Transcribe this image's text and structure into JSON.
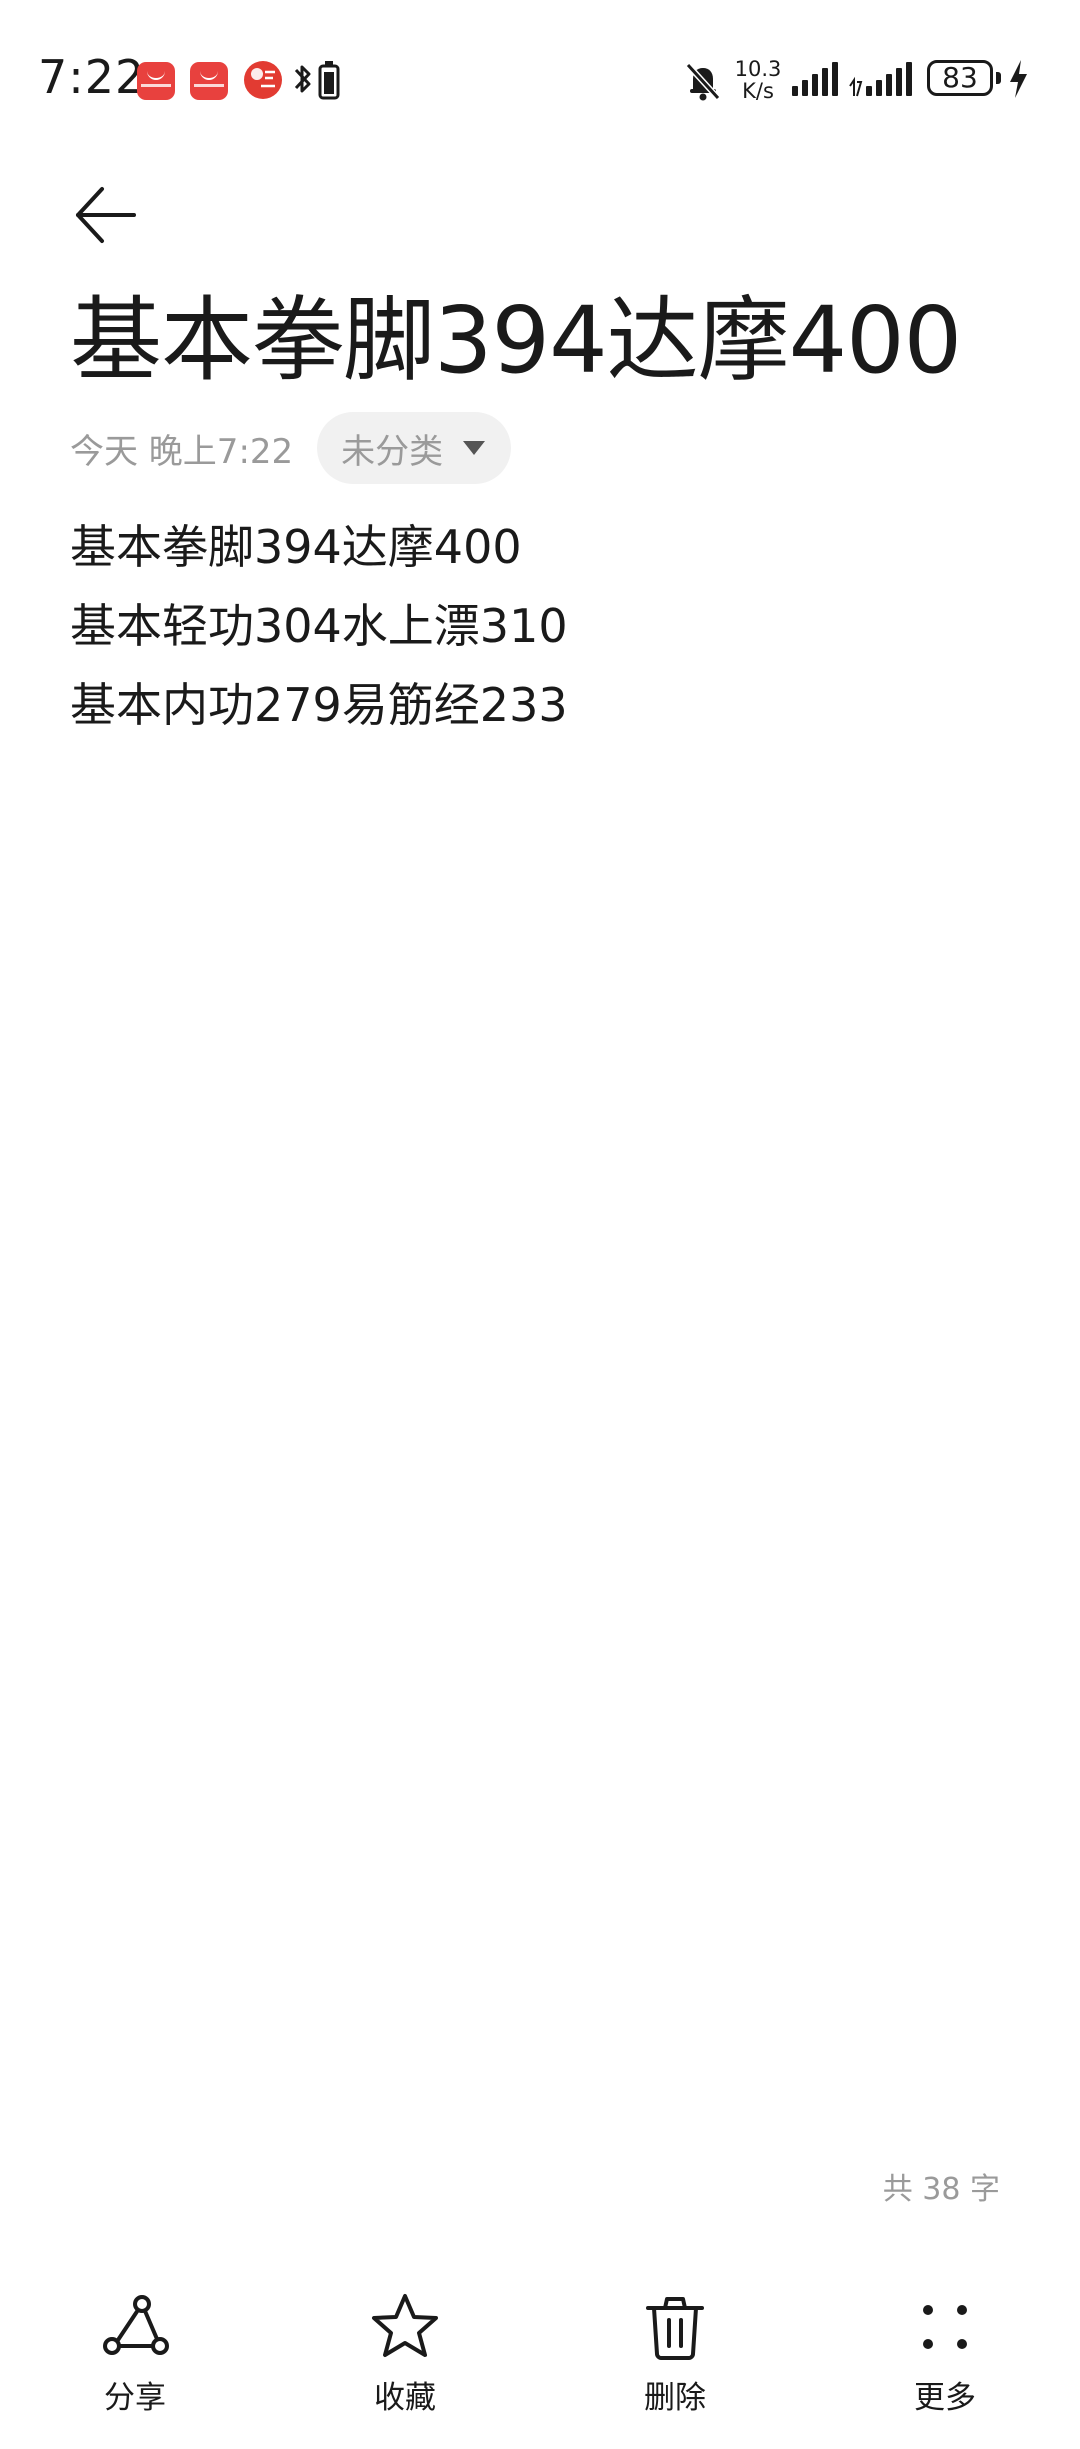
{
  "status_bar": {
    "time": "7:22",
    "net_speed_value": "10.3",
    "net_speed_unit": "K/s",
    "battery_level": "83"
  },
  "note": {
    "title": "基本拳脚394达摩400",
    "date": "今天 晚上7:22",
    "category": "未分类",
    "lines": [
      "基本拳脚394达摩400",
      "基本轻功304水上漂310",
      "基本内功279易筋经233"
    ],
    "word_count": "共 38 字"
  },
  "toolbar": {
    "share_label": "分享",
    "favorite_label": "收藏",
    "delete_label": "删除",
    "more_label": "更多"
  }
}
